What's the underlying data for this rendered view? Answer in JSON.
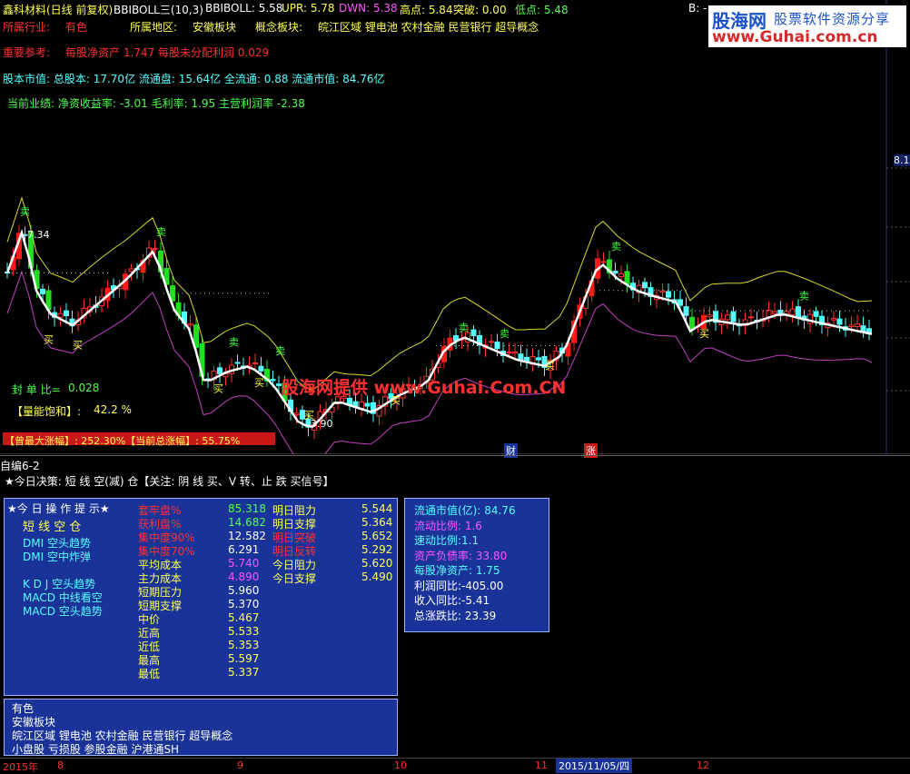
{
  "header": {
    "title": "鑫科材料(日线 前复权)",
    "boll_name": "BBIBOLL三(10,3)",
    "bbiboll": "BBIBOLL: 5.58",
    "upr": "UPR: 5.78",
    "dwn": "DWN: 5.38",
    "high": "高点: 5.84",
    "breakout": "突破: 0.00",
    "low": "低点: 5.48",
    "corner": "B: -"
  },
  "info": {
    "industry_label": "所属行业:",
    "industry": "有色",
    "region_label": "所属地区:",
    "region": "安徽板块",
    "concept_label": "概念板块:",
    "concepts": "皖江区域 锂电池 农村金融 民营银行 超导概念",
    "ref_label": "重要参考:",
    "ref_text": "每股净资产 1.747 每股未分配利润 0.029",
    "cap_line": "股本市值: 总股本: 17.70亿 流通盘: 15.64亿 全流通: 0.88 流通市值: 84.76亿",
    "perf_line": "当前业绩: 净资收益率: -3.01 毛利率: 1.95 主营利润率 -2.38"
  },
  "chart": {
    "price_high_label": "7.34",
    "price_low_label": "3.90",
    "right_axis": "8.1",
    "seal_label": "封 单 比=",
    "seal_value": "0.028",
    "vol_label": "【量能饱和】:",
    "vol_value": "42.2 %",
    "max_rise": "【曾最大涨幅】: 252.30%【当前总涨幅】: 55.75%",
    "marker_cai": "财",
    "marker_zhang": "涨",
    "sell_glyph": "卖",
    "buy_glyph": "买",
    "colors": {
      "up": "#ff3030",
      "down": "#54ffff",
      "big_up": "#ff1a1a",
      "big_down": "#22dd22",
      "mid": "#ffffff",
      "upper": "#d8d830",
      "lower": "#c040c0"
    }
  },
  "strategy": {
    "panel_title": "自编6-2",
    "decision": "★今日决策: 短 线 空(减) 仓【关注: 阴 线 买、V 转、止 跌 买信号】"
  },
  "ops": {
    "title": "★今 日 操 作 提 示★",
    "short_pos": "短 线 空 仓",
    "signals": [
      "DMI 空头趋势",
      "DMI 空中炸弹",
      "",
      "K D J 空头趋势",
      "MACD 中线看空",
      "MACD 空头趋势"
    ],
    "stats": [
      {
        "label": "套牢盘%",
        "value": "85.318",
        "lc": "r",
        "vc": "g"
      },
      {
        "label": "获利盘%",
        "value": "14.682",
        "lc": "r",
        "vc": "g"
      },
      {
        "label": "集中度90%",
        "value": "12.582",
        "lc": "r",
        "vc": "w"
      },
      {
        "label": "集中度70%",
        "value": "6.291",
        "lc": "r",
        "vc": "w"
      },
      {
        "label": "平均成本",
        "value": "5.740",
        "lc": "y",
        "vc": "m"
      },
      {
        "label": "主力成本",
        "value": "4.890",
        "lc": "y",
        "vc": "m"
      },
      {
        "label": "短期压力",
        "value": "5.960",
        "lc": "y",
        "vc": "w"
      },
      {
        "label": "短期支撑",
        "value": "5.370",
        "lc": "y",
        "vc": "w"
      },
      {
        "label": "中价",
        "value": "5.467",
        "lc": "y",
        "vc": "y"
      },
      {
        "label": "近高",
        "value": "5.533",
        "lc": "y",
        "vc": "y"
      },
      {
        "label": "近低",
        "value": "5.353",
        "lc": "y",
        "vc": "y"
      },
      {
        "label": "最高",
        "value": "5.597",
        "lc": "y",
        "vc": "y"
      },
      {
        "label": "最低",
        "value": "5.337",
        "lc": "y",
        "vc": "y"
      }
    ],
    "levels": [
      {
        "label": "明日阻力",
        "value": "5.544",
        "lc": "y",
        "vc": "y"
      },
      {
        "label": "明日支撑",
        "value": "5.364",
        "lc": "y",
        "vc": "y"
      },
      {
        "label": "明日突破",
        "value": "5.652",
        "lc": "r",
        "vc": "y"
      },
      {
        "label": "明日反转",
        "value": "5.292",
        "lc": "r",
        "vc": "y"
      },
      {
        "label": "今日阻力",
        "value": "5.620",
        "lc": "y",
        "vc": "y"
      },
      {
        "label": "今日支撑",
        "value": "5.490",
        "lc": "y",
        "vc": "y"
      }
    ]
  },
  "fund": {
    "items": [
      {
        "label": "流通市值(亿): 84.76",
        "c": "c"
      },
      {
        "label": "流动比例: 1.6",
        "c": "m"
      },
      {
        "label": "速动比例:1.1",
        "c": "c"
      },
      {
        "label": "资产负债率: 33.80",
        "c": "m"
      },
      {
        "label": "每股净资产: 1.75",
        "c": "c"
      },
      {
        "label": "利润同比:-405.00",
        "c": "w"
      },
      {
        "label": "收入同比:-5.41",
        "c": "w"
      },
      {
        "label": "总涨跌比: 23.39",
        "c": "w"
      }
    ]
  },
  "tags": {
    "lines": [
      "有色",
      "安徽板块",
      "皖江区域 锂电池 农村金融 民营银行 超导概念",
      "小盘股 亏损股 参股金融 沪港通SH"
    ]
  },
  "xaxis": {
    "labels": [
      "2015年",
      "8",
      "9",
      "10",
      "11",
      "2015/11/05/四",
      "12"
    ]
  },
  "watermark": {
    "site_cn": "股海网",
    "tagline": "股票软件资源分享",
    "url": "www.Guhai.com.cn",
    "center": "股海网提供 www.Guhai.Com.CN"
  }
}
